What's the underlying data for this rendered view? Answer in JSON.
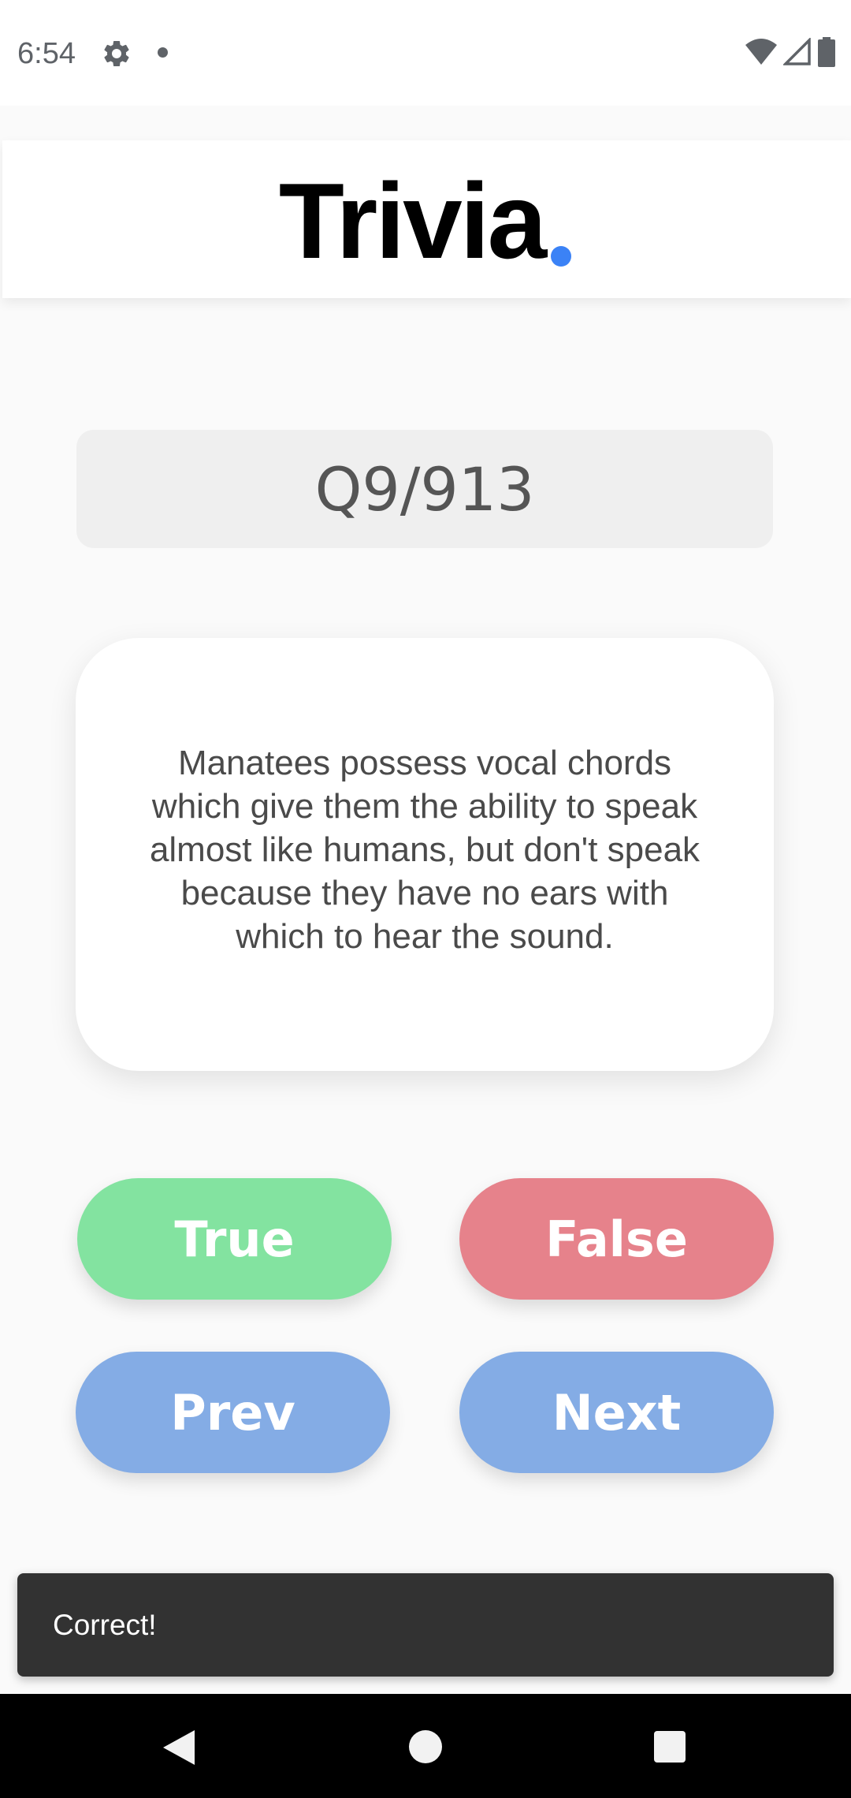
{
  "status_bar": {
    "time": "6:54",
    "icons": [
      "gear-icon",
      "notification-dot-icon",
      "wifi-icon",
      "cell-signal-icon",
      "battery-icon"
    ]
  },
  "header": {
    "title": "Trivia",
    "accent_color": "#3b82f6"
  },
  "quiz": {
    "counter": "Q9/913",
    "question": "Manatees possess vocal chords which give them the ability to speak almost like humans, but don't speak because they have no ears with which to hear the sound."
  },
  "buttons": {
    "true_label": "True",
    "false_label": "False",
    "prev_label": "Prev",
    "next_label": "Next",
    "true_color": "#83e3a0",
    "false_color": "#e6828b",
    "nav_color": "#84ace5"
  },
  "snackbar": {
    "message": "Correct!"
  },
  "nav_bar": {
    "icons": [
      "back-icon",
      "home-icon",
      "recents-icon"
    ]
  }
}
